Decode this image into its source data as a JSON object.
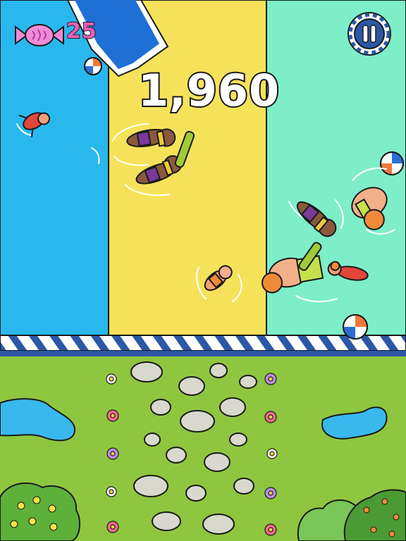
{
  "hud": {
    "candy_icon": "candy-icon",
    "candy_count": "25",
    "score": "1,960",
    "pause_icon": "pause-icon"
  },
  "colors": {
    "lane_blue": "#29b8ee",
    "lane_yellow": "#f6e25a",
    "lane_mint": "#7eeec8",
    "grass": "#8fc63f",
    "pool_edge": "#2b58a6",
    "candy": "#f08ad6"
  }
}
